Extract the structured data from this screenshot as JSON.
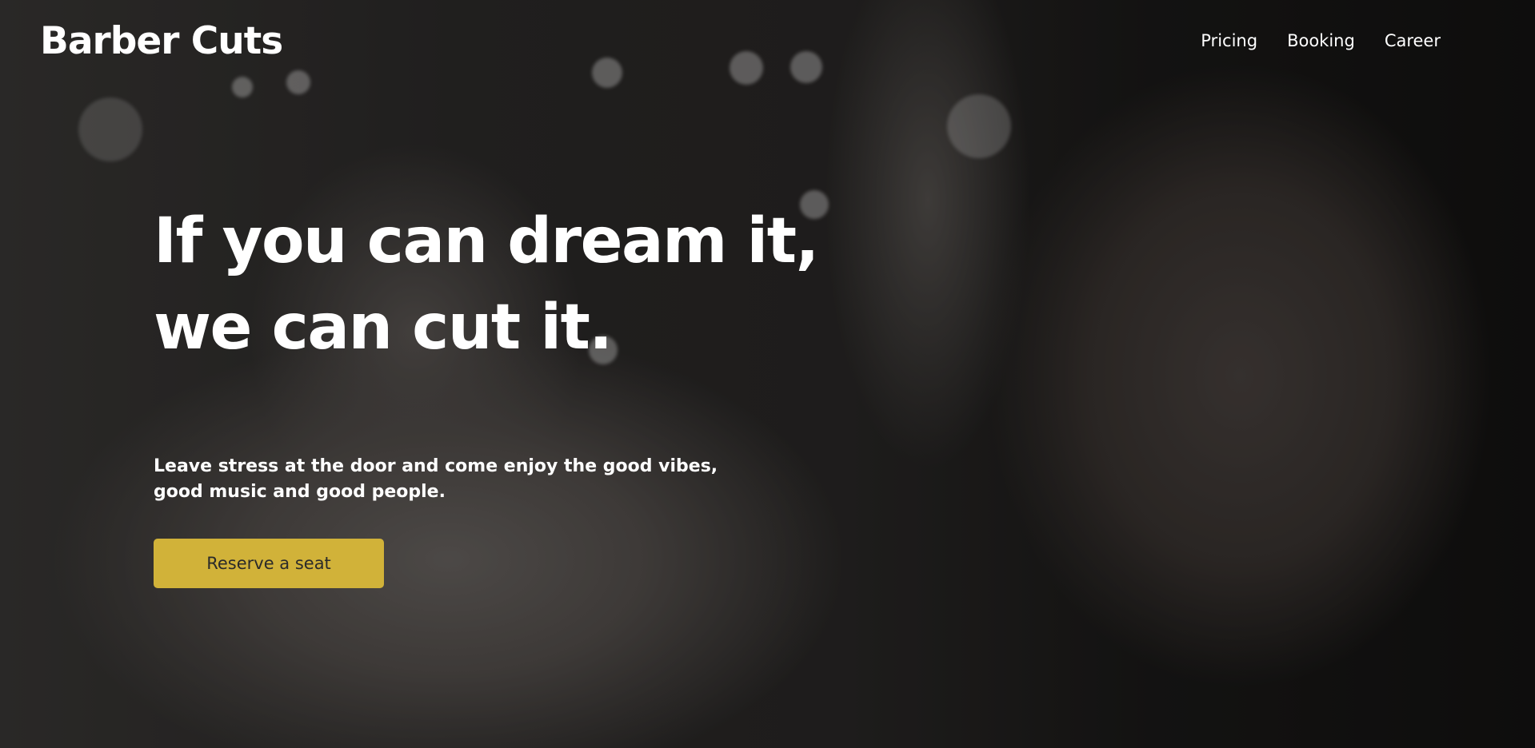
{
  "brand": {
    "name": "Barber Cuts"
  },
  "nav": {
    "links": [
      {
        "label": "Pricing"
      },
      {
        "label": "Booking"
      },
      {
        "label": "Career"
      }
    ]
  },
  "hero": {
    "headline_line1": "If you can dream it,",
    "headline_line2": "we can cut it.",
    "subtext_line1": "Leave stress at the door and come enjoy the good vibes,",
    "subtext_line2": "good music and good people.",
    "cta_label": "Reserve a seat",
    "background": "blurred barbershop photo with dark overlay"
  },
  "colors": {
    "accent": "#d1b239",
    "text": "#ffffff",
    "cta_text": "#2a2a2a"
  }
}
